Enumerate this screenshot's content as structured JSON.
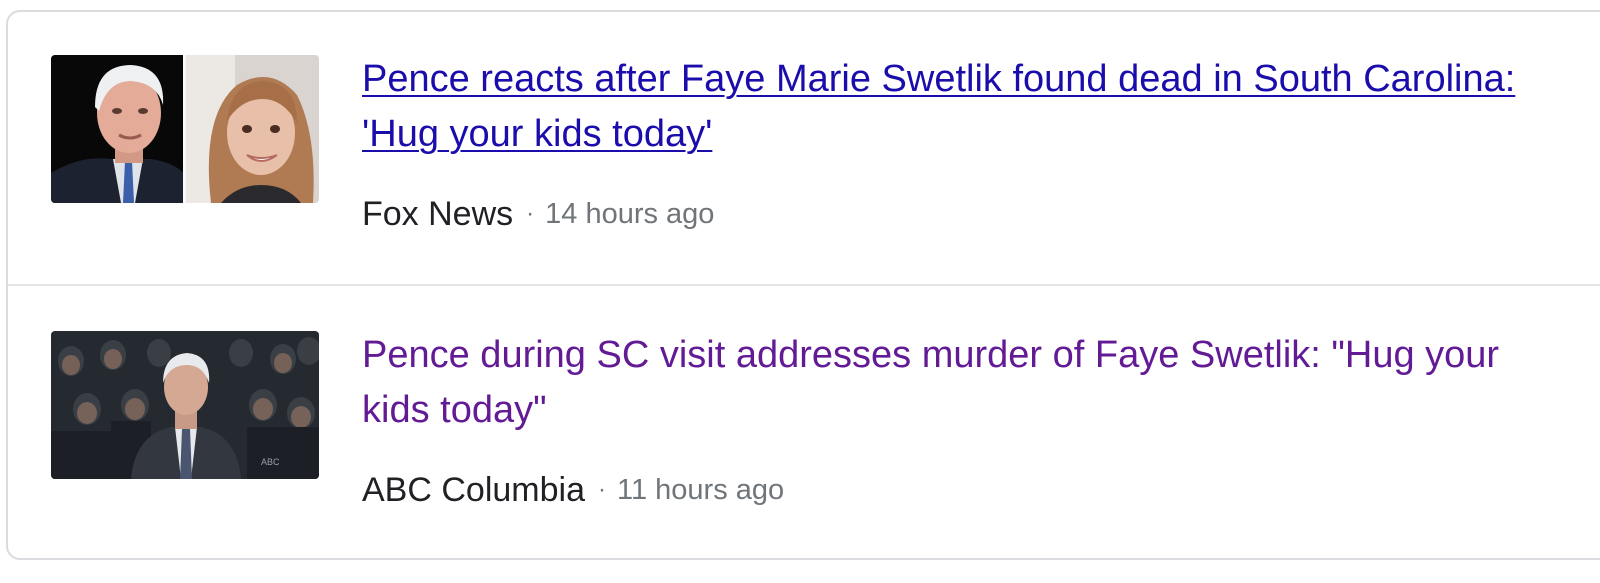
{
  "stories": [
    {
      "headline": "Pence reacts after Faye Marie Swetlik found dead in South Carolina: 'Hug your kids today'",
      "source": "Fox News",
      "separator": "·",
      "time": "14 hours ago",
      "link_state": "unvisited",
      "link_color": "#1a0dab"
    },
    {
      "headline": "Pence during SC visit addresses murder of Faye Swetlik: \"Hug your kids today\"",
      "source": "ABC Columbia",
      "separator": "·",
      "time": "11 hours ago",
      "link_state": "visited",
      "link_color": "#621b95"
    }
  ],
  "colors": {
    "source_text": "#202124",
    "meta_gray": "#70757a",
    "border": "#dadce0"
  }
}
